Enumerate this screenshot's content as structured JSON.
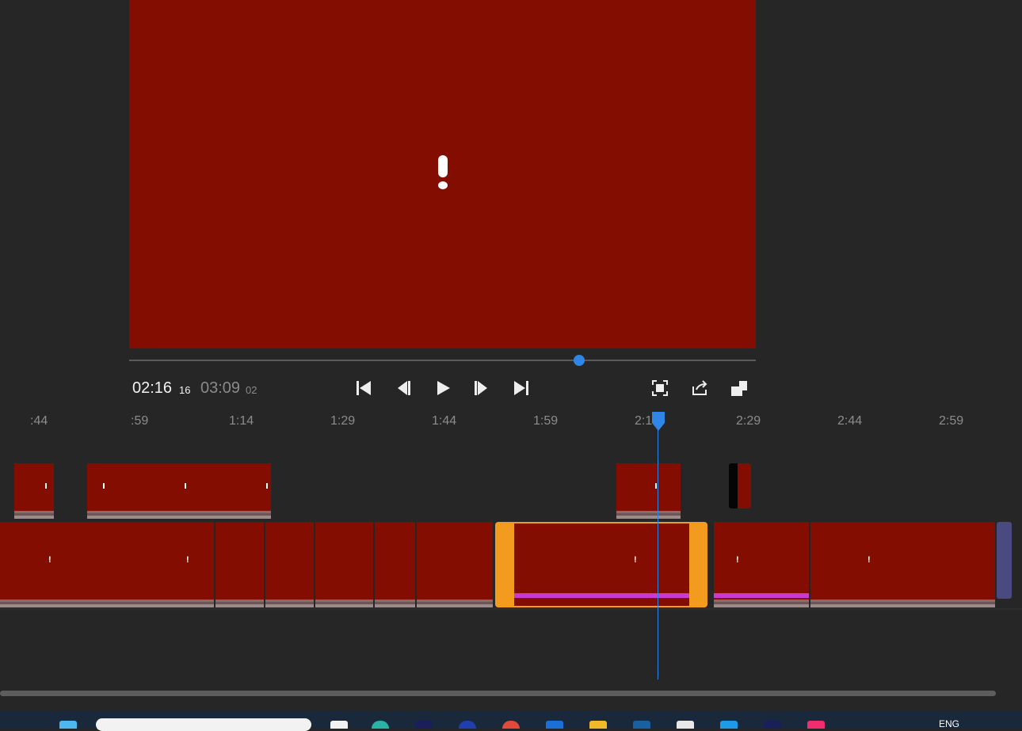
{
  "player": {
    "current_time": "02:16",
    "current_frames": "16",
    "total_time": "03:09",
    "total_frames": "02",
    "scrub_progress": 0.718,
    "controls": [
      "skip-to-start",
      "step-back",
      "play",
      "step-forward",
      "skip-to-end",
      "fit-screen",
      "export",
      "detach"
    ]
  },
  "timeline": {
    "ruler_labels": [
      ":44",
      ":59",
      "1:14",
      "1:29",
      "1:44",
      "1:59",
      "2:1",
      "2:29",
      "2:44",
      "2:59"
    ],
    "playhead_time": "2:1"
  },
  "taskbar": {
    "language": "ENG"
  },
  "colors": {
    "clip_missing": "#820d00",
    "selection": "#f39b1f",
    "accent": "#2f86e6",
    "magenta_effect": "#c93bd0",
    "background": "#262626"
  }
}
